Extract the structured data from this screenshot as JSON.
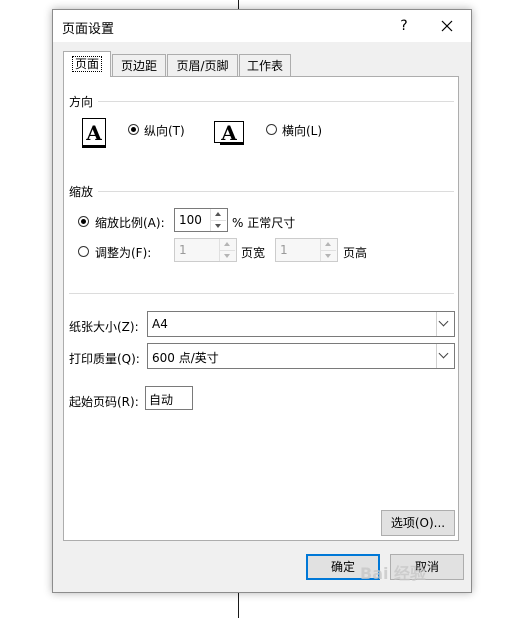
{
  "dialog": {
    "title": "页面设置",
    "help_label": "?",
    "tabs": [
      {
        "label": "页面"
      },
      {
        "label": "页边距"
      },
      {
        "label": "页眉/页脚"
      },
      {
        "label": "工作表"
      }
    ]
  },
  "orientation": {
    "group_title": "方向",
    "portrait_label": "纵向(T)",
    "landscape_label": "横向(L)",
    "icon_letter": "A",
    "selected": "portrait"
  },
  "scaling": {
    "group_title": "缩放",
    "scale_option_label": "缩放比例(A):",
    "scale_value": "100",
    "scale_suffix": "% 正常尺寸",
    "fit_option_label": "调整为(F):",
    "fit_width_value": "1",
    "fit_width_suffix": "页宽",
    "fit_height_value": "1",
    "fit_height_suffix": "页高",
    "selected": "scale"
  },
  "paper": {
    "size_label": "纸张大小(Z):",
    "size_value": "A4",
    "quality_label": "打印质量(Q):",
    "quality_value": "600 点/英寸",
    "first_page_label": "起始页码(R):",
    "first_page_value": "自动"
  },
  "buttons": {
    "options_label": "选项(O)...",
    "ok_label": "确定",
    "cancel_label": "取消"
  },
  "watermark_text": "Bai 经验"
}
